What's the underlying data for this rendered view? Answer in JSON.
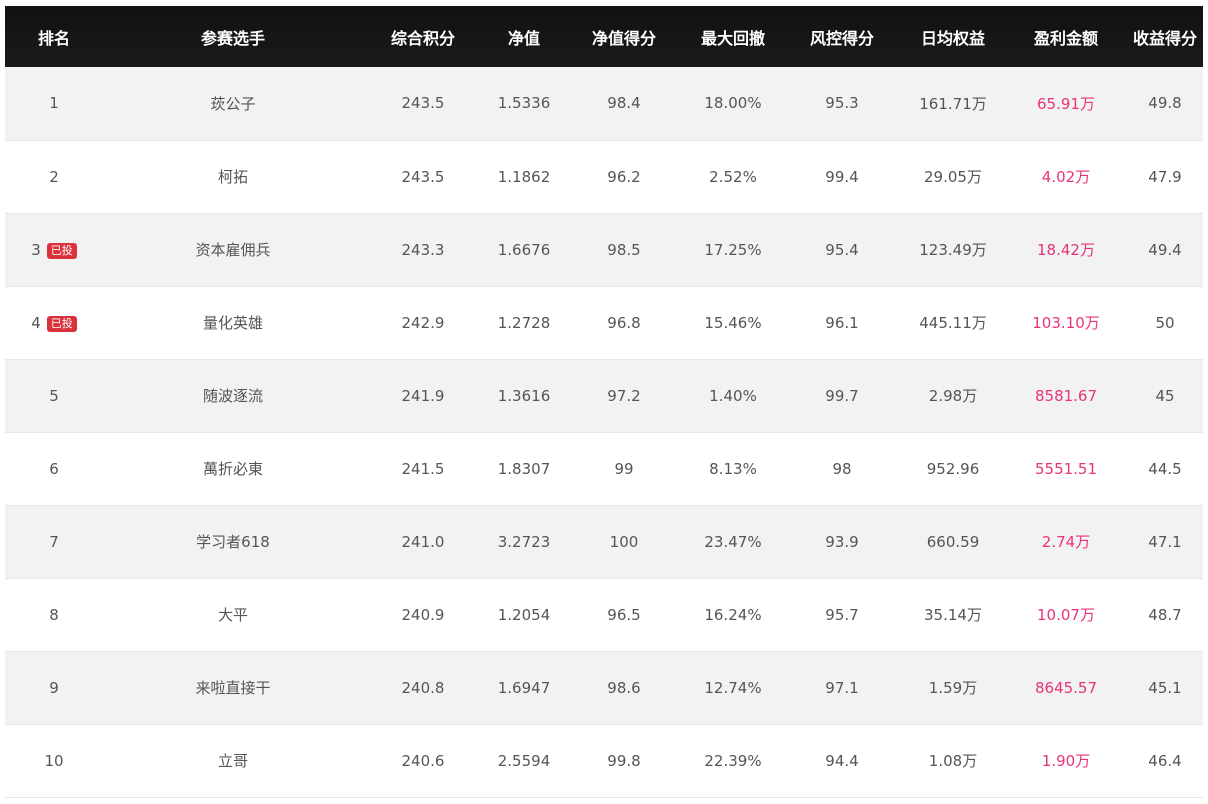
{
  "headers": [
    "排名",
    "参赛选手",
    "综合积分",
    "净值",
    "净值得分",
    "最大回撤",
    "风控得分",
    "日均权益",
    "盈利金额",
    "收益得分"
  ],
  "colors": {
    "header_bg": "#111111",
    "profit": "#e8337a",
    "badge": "#d9323d",
    "row_alt": "#f2f2f2"
  },
  "rows": [
    {
      "rank": "1",
      "badge": "",
      "name": "莰公子",
      "score": "243.5",
      "nav": "1.5336",
      "nav_score": "98.4",
      "drawdown": "18.00%",
      "risk_score": "95.3",
      "avg_equity": "161.71万",
      "profit": "65.91万",
      "return_score": "49.8"
    },
    {
      "rank": "2",
      "badge": "",
      "name": "柯拓",
      "score": "243.5",
      "nav": "1.1862",
      "nav_score": "96.2",
      "drawdown": "2.52%",
      "risk_score": "99.4",
      "avg_equity": "29.05万",
      "profit": "4.02万",
      "return_score": "47.9"
    },
    {
      "rank": "3",
      "badge": "已投",
      "name": "资本雇佣兵",
      "score": "243.3",
      "nav": "1.6676",
      "nav_score": "98.5",
      "drawdown": "17.25%",
      "risk_score": "95.4",
      "avg_equity": "123.49万",
      "profit": "18.42万",
      "return_score": "49.4"
    },
    {
      "rank": "4",
      "badge": "已投",
      "name": "量化英雄",
      "score": "242.9",
      "nav": "1.2728",
      "nav_score": "96.8",
      "drawdown": "15.46%",
      "risk_score": "96.1",
      "avg_equity": "445.11万",
      "profit": "103.10万",
      "return_score": "50"
    },
    {
      "rank": "5",
      "badge": "",
      "name": "随波逐流",
      "score": "241.9",
      "nav": "1.3616",
      "nav_score": "97.2",
      "drawdown": "1.40%",
      "risk_score": "99.7",
      "avg_equity": "2.98万",
      "profit": "8581.67",
      "return_score": "45"
    },
    {
      "rank": "6",
      "badge": "",
      "name": "萬折必東",
      "score": "241.5",
      "nav": "1.8307",
      "nav_score": "99",
      "drawdown": "8.13%",
      "risk_score": "98",
      "avg_equity": "952.96",
      "profit": "5551.51",
      "return_score": "44.5"
    },
    {
      "rank": "7",
      "badge": "",
      "name": "学习者618",
      "score": "241.0",
      "nav": "3.2723",
      "nav_score": "100",
      "drawdown": "23.47%",
      "risk_score": "93.9",
      "avg_equity": "660.59",
      "profit": "2.74万",
      "return_score": "47.1"
    },
    {
      "rank": "8",
      "badge": "",
      "name": "大平",
      "score": "240.9",
      "nav": "1.2054",
      "nav_score": "96.5",
      "drawdown": "16.24%",
      "risk_score": "95.7",
      "avg_equity": "35.14万",
      "profit": "10.07万",
      "return_score": "48.7"
    },
    {
      "rank": "9",
      "badge": "",
      "name": "来啦直接干",
      "score": "240.8",
      "nav": "1.6947",
      "nav_score": "98.6",
      "drawdown": "12.74%",
      "risk_score": "97.1",
      "avg_equity": "1.59万",
      "profit": "8645.57",
      "return_score": "45.1"
    },
    {
      "rank": "10",
      "badge": "",
      "name": "立哥",
      "score": "240.6",
      "nav": "2.5594",
      "nav_score": "99.8",
      "drawdown": "22.39%",
      "risk_score": "94.4",
      "avg_equity": "1.08万",
      "profit": "1.90万",
      "return_score": "46.4"
    }
  ]
}
